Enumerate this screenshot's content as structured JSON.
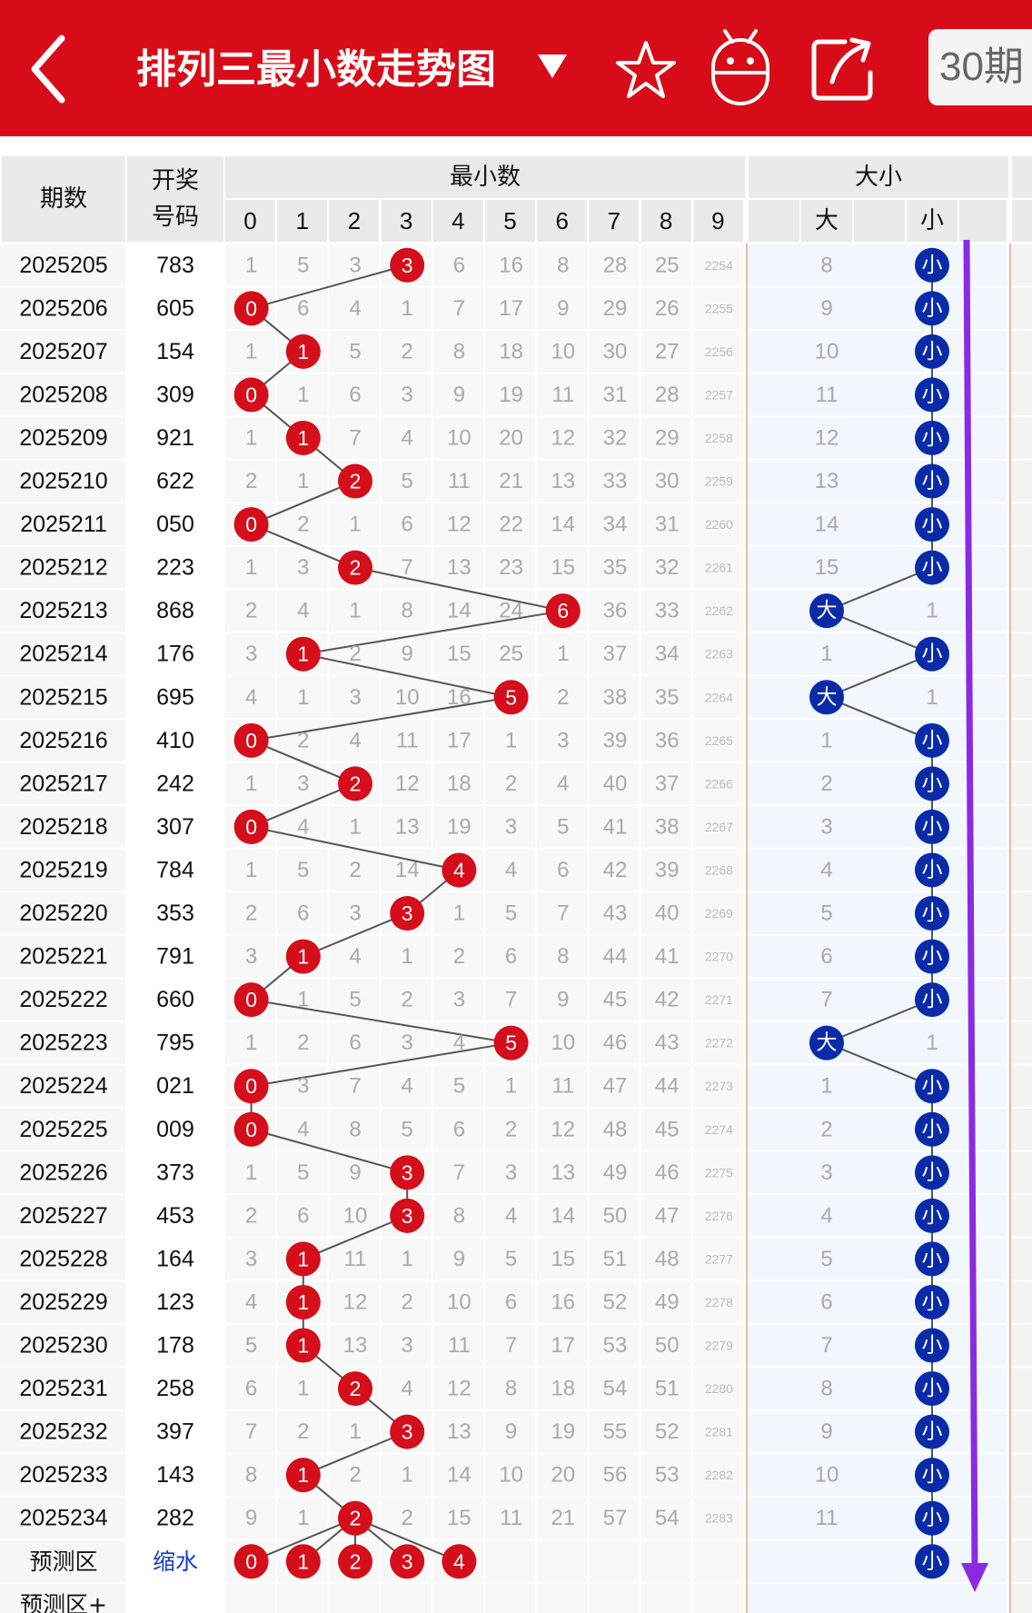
{
  "header": {
    "title": "排列三最小数走势图",
    "period_label": "30期"
  },
  "icons": [
    "back-icon",
    "dropdown-triangle-icon",
    "star-icon",
    "robot-icon",
    "share-icon"
  ],
  "colors": {
    "header_bg": "#d80c18",
    "red_ball": "#d40e1a",
    "blue_ball": "#0a2ba8",
    "trend_arrow": "#8a2be2"
  },
  "table": {
    "issue_header": "期数",
    "draw_header_line1": "开奖",
    "draw_header_line2": "号码",
    "min_group_header": "最小数",
    "size_group_header": "大小",
    "digit_headers": [
      "0",
      "1",
      "2",
      "3",
      "4",
      "5",
      "6",
      "7",
      "8",
      "9"
    ],
    "size_big_header": "大",
    "size_small_header": "小",
    "rows": [
      {
        "issue": "2025205",
        "draw": "783",
        "min": 3,
        "size": "小",
        "miss": [
          1,
          5,
          3,
          null,
          6,
          16,
          8,
          28,
          25,
          2254
        ],
        "big_miss": 8
      },
      {
        "issue": "2025206",
        "draw": "605",
        "min": 0,
        "size": "小",
        "miss": [
          null,
          6,
          4,
          1,
          7,
          17,
          9,
          29,
          26,
          2255
        ],
        "big_miss": 9
      },
      {
        "issue": "2025207",
        "draw": "154",
        "min": 1,
        "size": "小",
        "miss": [
          1,
          null,
          5,
          2,
          8,
          18,
          10,
          30,
          27,
          2256
        ],
        "big_miss": 10
      },
      {
        "issue": "2025208",
        "draw": "309",
        "min": 0,
        "size": "小",
        "miss": [
          null,
          1,
          6,
          3,
          9,
          19,
          11,
          31,
          28,
          2257
        ],
        "big_miss": 11
      },
      {
        "issue": "2025209",
        "draw": "921",
        "min": 1,
        "size": "小",
        "miss": [
          1,
          null,
          7,
          4,
          10,
          20,
          12,
          32,
          29,
          2258
        ],
        "big_miss": 12
      },
      {
        "issue": "2025210",
        "draw": "622",
        "min": 2,
        "size": "小",
        "miss": [
          2,
          1,
          null,
          5,
          11,
          21,
          13,
          33,
          30,
          2259
        ],
        "big_miss": 13
      },
      {
        "issue": "2025211",
        "draw": "050",
        "min": 0,
        "size": "小",
        "miss": [
          null,
          2,
          1,
          6,
          12,
          22,
          14,
          34,
          31,
          2260
        ],
        "big_miss": 14
      },
      {
        "issue": "2025212",
        "draw": "223",
        "min": 2,
        "size": "小",
        "miss": [
          1,
          3,
          null,
          7,
          13,
          23,
          15,
          35,
          32,
          2261
        ],
        "big_miss": 15
      },
      {
        "issue": "2025213",
        "draw": "868",
        "min": 6,
        "size": "大",
        "miss": [
          2,
          4,
          1,
          8,
          14,
          24,
          null,
          36,
          33,
          2262
        ],
        "small_miss": 1
      },
      {
        "issue": "2025214",
        "draw": "176",
        "min": 1,
        "size": "小",
        "miss": [
          3,
          null,
          2,
          9,
          15,
          25,
          1,
          37,
          34,
          2263
        ],
        "big_miss": 1
      },
      {
        "issue": "2025215",
        "draw": "695",
        "min": 5,
        "size": "大",
        "miss": [
          4,
          1,
          3,
          10,
          16,
          null,
          2,
          38,
          35,
          2264
        ],
        "small_miss": 1
      },
      {
        "issue": "2025216",
        "draw": "410",
        "min": 0,
        "size": "小",
        "miss": [
          null,
          2,
          4,
          11,
          17,
          1,
          3,
          39,
          36,
          2265
        ],
        "big_miss": 1
      },
      {
        "issue": "2025217",
        "draw": "242",
        "min": 2,
        "size": "小",
        "miss": [
          1,
          3,
          null,
          12,
          18,
          2,
          4,
          40,
          37,
          2266
        ],
        "big_miss": 2
      },
      {
        "issue": "2025218",
        "draw": "307",
        "min": 0,
        "size": "小",
        "miss": [
          null,
          4,
          1,
          13,
          19,
          3,
          5,
          41,
          38,
          2267
        ],
        "big_miss": 3
      },
      {
        "issue": "2025219",
        "draw": "784",
        "min": 4,
        "size": "小",
        "miss": [
          1,
          5,
          2,
          14,
          null,
          4,
          6,
          42,
          39,
          2268
        ],
        "big_miss": 4
      },
      {
        "issue": "2025220",
        "draw": "353",
        "min": 3,
        "size": "小",
        "miss": [
          2,
          6,
          3,
          null,
          1,
          5,
          7,
          43,
          40,
          2269
        ],
        "big_miss": 5
      },
      {
        "issue": "2025221",
        "draw": "791",
        "min": 1,
        "size": "小",
        "miss": [
          3,
          null,
          4,
          1,
          2,
          6,
          8,
          44,
          41,
          2270
        ],
        "big_miss": 6
      },
      {
        "issue": "2025222",
        "draw": "660",
        "min": 0,
        "size": "小",
        "miss": [
          null,
          1,
          5,
          2,
          3,
          7,
          9,
          45,
          42,
          2271
        ],
        "big_miss": 7
      },
      {
        "issue": "2025223",
        "draw": "795",
        "min": 5,
        "size": "大",
        "miss": [
          1,
          2,
          6,
          3,
          4,
          null,
          10,
          46,
          43,
          2272
        ],
        "small_miss": 1
      },
      {
        "issue": "2025224",
        "draw": "021",
        "min": 0,
        "size": "小",
        "miss": [
          null,
          3,
          7,
          4,
          5,
          1,
          11,
          47,
          44,
          2273
        ],
        "big_miss": 1
      },
      {
        "issue": "2025225",
        "draw": "009",
        "min": 0,
        "size": "小",
        "miss": [
          null,
          4,
          8,
          5,
          6,
          2,
          12,
          48,
          45,
          2274
        ],
        "big_miss": 2
      },
      {
        "issue": "2025226",
        "draw": "373",
        "min": 3,
        "size": "小",
        "miss": [
          1,
          5,
          9,
          null,
          7,
          3,
          13,
          49,
          46,
          2275
        ],
        "big_miss": 3
      },
      {
        "issue": "2025227",
        "draw": "453",
        "min": 3,
        "size": "小",
        "miss": [
          2,
          6,
          10,
          null,
          8,
          4,
          14,
          50,
          47,
          2276
        ],
        "big_miss": 4
      },
      {
        "issue": "2025228",
        "draw": "164",
        "min": 1,
        "size": "小",
        "miss": [
          3,
          null,
          11,
          1,
          9,
          5,
          15,
          51,
          48,
          2277
        ],
        "big_miss": 5
      },
      {
        "issue": "2025229",
        "draw": "123",
        "min": 1,
        "size": "小",
        "miss": [
          4,
          null,
          12,
          2,
          10,
          6,
          16,
          52,
          49,
          2278
        ],
        "big_miss": 6
      },
      {
        "issue": "2025230",
        "draw": "178",
        "min": 1,
        "size": "小",
        "miss": [
          5,
          null,
          13,
          3,
          11,
          7,
          17,
          53,
          50,
          2279
        ],
        "big_miss": 7
      },
      {
        "issue": "2025231",
        "draw": "258",
        "min": 2,
        "size": "小",
        "miss": [
          6,
          1,
          null,
          4,
          12,
          8,
          18,
          54,
          51,
          2280
        ],
        "big_miss": 8
      },
      {
        "issue": "2025232",
        "draw": "397",
        "min": 3,
        "size": "小",
        "miss": [
          7,
          2,
          1,
          null,
          13,
          9,
          19,
          55,
          52,
          2281
        ],
        "big_miss": 9
      },
      {
        "issue": "2025233",
        "draw": "143",
        "min": 1,
        "size": "小",
        "miss": [
          8,
          null,
          2,
          1,
          14,
          10,
          20,
          56,
          53,
          2282
        ],
        "big_miss": 10
      },
      {
        "issue": "2025234",
        "draw": "282",
        "min": 2,
        "size": "小",
        "miss": [
          9,
          1,
          null,
          2,
          15,
          11,
          21,
          57,
          54,
          2283
        ],
        "big_miss": 11
      }
    ],
    "prediction": {
      "label": "预测区",
      "note": "缩水",
      "digits": [
        0,
        1,
        2,
        3,
        4
      ],
      "size": "小"
    },
    "prediction_plus_label": "预测区+"
  }
}
